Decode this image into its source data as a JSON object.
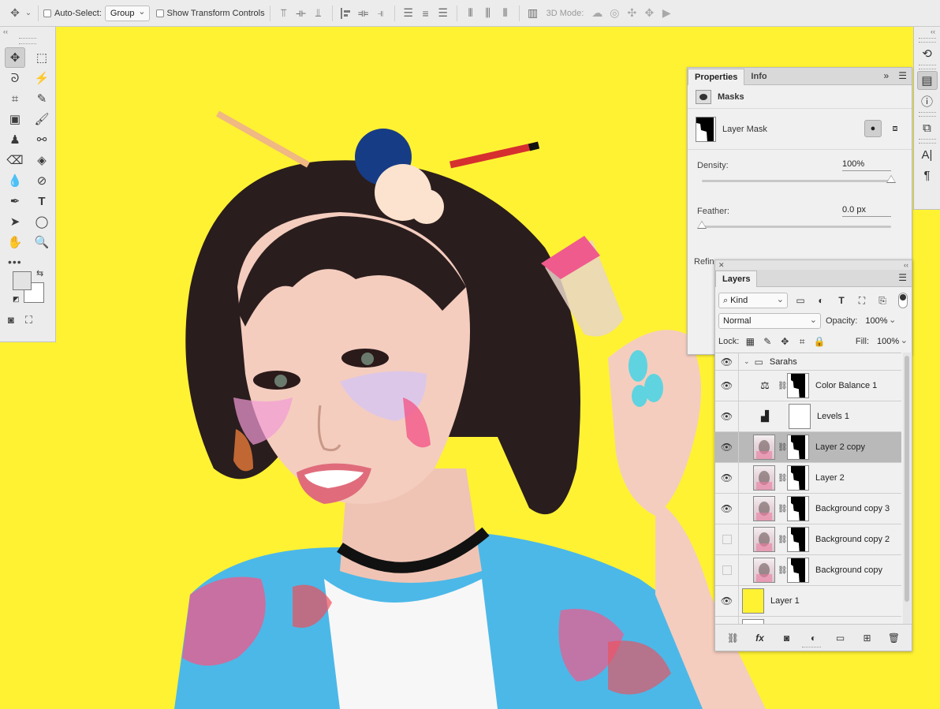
{
  "options_bar": {
    "auto_select_label": "Auto-Select:",
    "auto_select_value": "Group",
    "transform_label": "Show Transform Controls",
    "mode_3d_label": "3D Mode:"
  },
  "tools": {
    "collapse_glyph": "‹‹"
  },
  "dock": {
    "collapse_glyph": "‹‹"
  },
  "properties": {
    "tabs": [
      "Properties",
      "Info"
    ],
    "section_label": "Masks",
    "mask_type": "Layer Mask",
    "density_label": "Density:",
    "density_value": "100%",
    "density_level": 1.0,
    "feather_label": "Feather:",
    "feather_value": "0.0 px",
    "feather_level": 0.0,
    "refine_label": "Refine"
  },
  "layers_panel": {
    "tab": "Layers",
    "filter_kind": "Kind",
    "blend_mode": "Normal",
    "opacity_label": "Opacity:",
    "opacity_value": "100%",
    "lock_label": "Lock:",
    "fill_label": "Fill:",
    "fill_value": "100%",
    "layers": [
      {
        "name": "Sarahs",
        "kind": "group",
        "visible": true
      },
      {
        "name": "Color Balance 1",
        "kind": "adjustment",
        "icon": "balance-icon",
        "visible": true
      },
      {
        "name": "Levels 1",
        "kind": "adjustment",
        "icon": "levels-icon",
        "visible": true
      },
      {
        "name": "Layer 2 copy",
        "kind": "pixel-mask",
        "visible": true,
        "selected": true
      },
      {
        "name": "Layer 2",
        "kind": "pixel-mask",
        "visible": true
      },
      {
        "name": "Background copy 3",
        "kind": "pixel-mask",
        "visible": true
      },
      {
        "name": "Background copy 2",
        "kind": "pixel-mask",
        "visible": false
      },
      {
        "name": "Background copy",
        "kind": "pixel-mask",
        "visible": false
      },
      {
        "name": "Layer 1",
        "kind": "fill",
        "visible": true
      }
    ]
  },
  "colors": {
    "canvas_background": "#fff233",
    "panel_bg": "#f0f0f0",
    "selected_layer": "#b9b9b9"
  }
}
